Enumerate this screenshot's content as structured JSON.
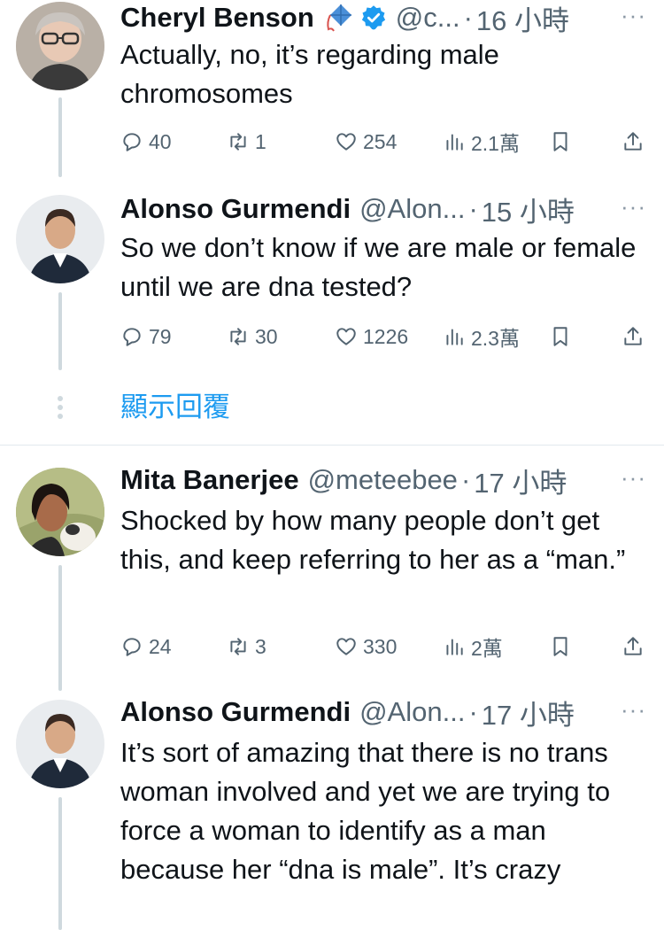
{
  "tweets": [
    {
      "name": "Cheryl Benson",
      "handle": "@c...",
      "separator": "·",
      "time": "16 小時",
      "text": "Actually, no, it’s regarding male chromosomes",
      "replies": "40",
      "retweets": "1",
      "likes": "254",
      "views": "2.1萬",
      "emoji": "kite-emoji",
      "verified": true
    },
    {
      "name": "Alonso Gurmendi",
      "handle": "@Alon...",
      "separator": "·",
      "time": "15 小時",
      "text": "So we don’t know if we are male or female until we are dna tested?",
      "replies": "79",
      "retweets": "30",
      "likes": "1226",
      "views": "2.3萬"
    },
    {
      "name": "Mita Banerjee",
      "handle": "@meteebee",
      "separator": "·",
      "time": "17 小時",
      "text": "Shocked by how many people don’t get this, and keep referring to her as a “man.”",
      "replies": "24",
      "retweets": "3",
      "likes": "330",
      "views": "2萬"
    },
    {
      "name": "Alonso Gurmendi",
      "handle": "@Alon...",
      "separator": "·",
      "time": "17 小時",
      "text": "It’s sort of amazing that there is no trans woman involved and yet we are trying to force a woman to identify as a man because her “dna is male”. It’s crazy"
    }
  ],
  "show_replies_label": "顯示回覆",
  "more_label": "···",
  "colors": {
    "accent": "#1d9bf0",
    "text": "#0f1419",
    "secondary": "#536471",
    "thread_line": "#cfd9de"
  }
}
